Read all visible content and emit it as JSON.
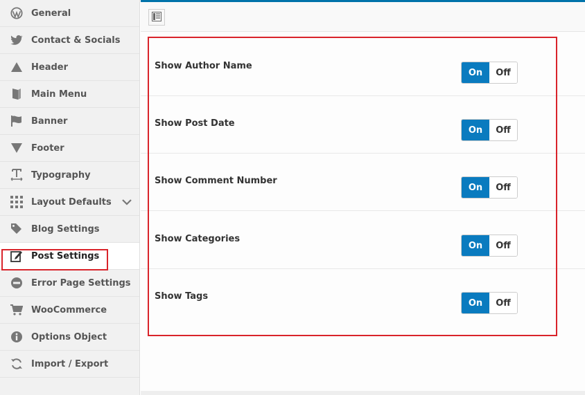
{
  "sidebar": {
    "items": [
      {
        "label": "General",
        "icon": "wordpress-icon"
      },
      {
        "label": "Contact & Socials",
        "icon": "twitter-icon"
      },
      {
        "label": "Header",
        "icon": "triangle-up-icon"
      },
      {
        "label": "Main Menu",
        "icon": "book-icon"
      },
      {
        "label": "Banner",
        "icon": "flag-icon"
      },
      {
        "label": "Footer",
        "icon": "triangle-down-icon"
      },
      {
        "label": "Typography",
        "icon": "text-width-icon"
      },
      {
        "label": "Layout Defaults",
        "icon": "grid-icon"
      },
      {
        "label": "Blog Settings",
        "icon": "tags-icon"
      },
      {
        "label": "Post Settings",
        "icon": "edit-icon"
      },
      {
        "label": "Error Page Settings",
        "icon": "minus-circle-icon"
      },
      {
        "label": "WooCommerce",
        "icon": "cart-icon"
      },
      {
        "label": "Options Object",
        "icon": "info-icon"
      },
      {
        "label": "Import / Export",
        "icon": "refresh-icon"
      }
    ],
    "active_index": 9
  },
  "toolbar": {
    "expand_icon": "panel-icon"
  },
  "settings": [
    {
      "label": "Show Author Name",
      "on_label": "On",
      "off_label": "Off",
      "value": "on"
    },
    {
      "label": "Show Post Date",
      "on_label": "On",
      "off_label": "Off",
      "value": "on"
    },
    {
      "label": "Show Comment Number",
      "on_label": "On",
      "off_label": "Off",
      "value": "on"
    },
    {
      "label": "Show Categories",
      "on_label": "On",
      "off_label": "Off",
      "value": "on"
    },
    {
      "label": "Show Tags",
      "on_label": "On",
      "off_label": "Off",
      "value": "on"
    }
  ],
  "colors": {
    "accent": "#0a7bbf",
    "highlight": "#d9232a",
    "top_line": "#0073aa"
  }
}
